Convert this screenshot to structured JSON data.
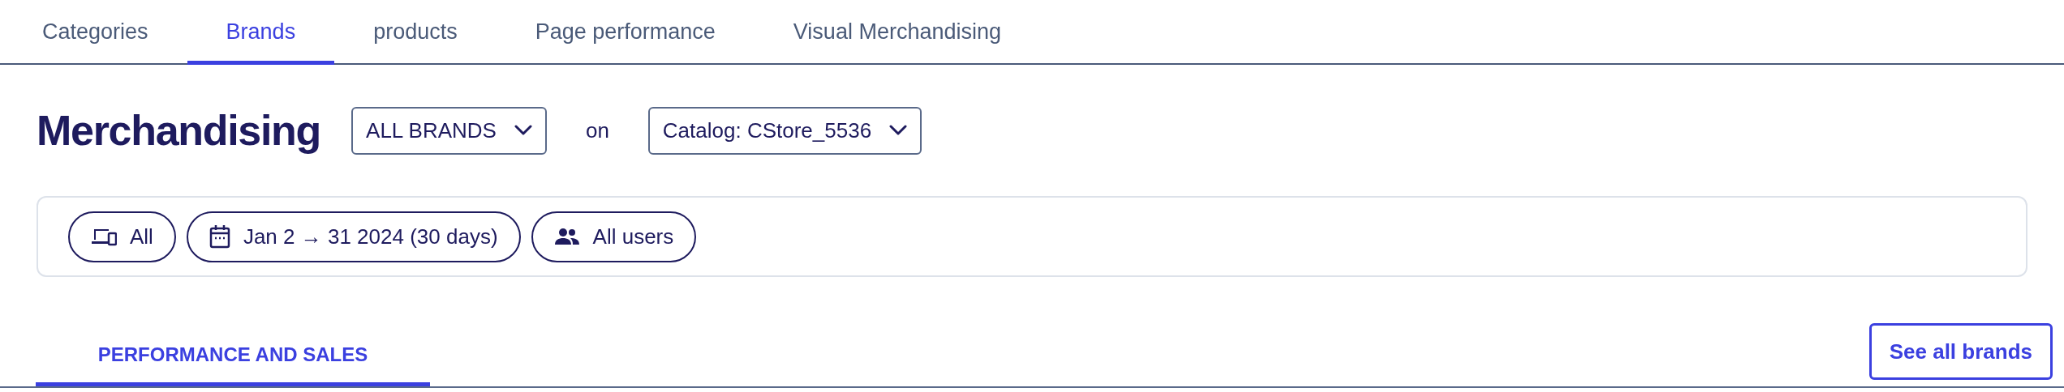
{
  "tabs": [
    {
      "label": "Categories",
      "selected": false
    },
    {
      "label": "Brands",
      "selected": true
    },
    {
      "label": "products",
      "selected": false
    },
    {
      "label": "Page performance",
      "selected": false
    },
    {
      "label": "Visual Merchandising",
      "selected": false
    }
  ],
  "header": {
    "title": "Merchandising",
    "brand_dropdown": "ALL BRANDS",
    "connector": "on",
    "catalog_dropdown": "Catalog: CStore_5536"
  },
  "filters": [
    {
      "kind": "device",
      "label": "All"
    },
    {
      "kind": "date",
      "label": "Jan 2 → 31 2024 (30 days)"
    },
    {
      "kind": "users",
      "label": "All users"
    }
  ],
  "section_tabs": [
    {
      "label": "PERFORMANCE AND SALES",
      "selected": true
    }
  ],
  "see_all_button": "See all brands"
}
